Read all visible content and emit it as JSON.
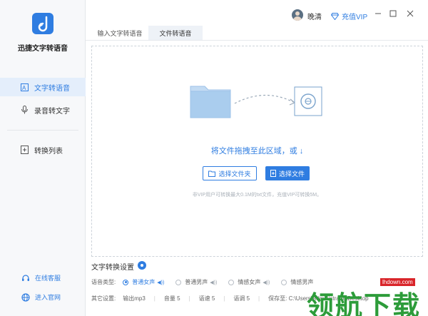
{
  "app": {
    "name": "迅捷文字转语音"
  },
  "sidebar": {
    "items": [
      {
        "label": "文字转语音"
      },
      {
        "label": "录音转文字"
      },
      {
        "label": "转换列表"
      }
    ],
    "footer": [
      {
        "label": "在线客服"
      },
      {
        "label": "进入官网"
      }
    ]
  },
  "header": {
    "username": "晚清",
    "vip_label": "充值VIP"
  },
  "tabs": [
    {
      "label": "输入文字转语音"
    },
    {
      "label": "文件转语音"
    }
  ],
  "dropzone": {
    "text": "将文件拖拽至此区域，或 ↓",
    "select_folder": "选择文件夹",
    "select_file": "选择文件",
    "hint": "非VIP用户可转换最大0.1M的txt文件，充值VIP可转换5M。"
  },
  "settings": {
    "title": "文字转换设置",
    "voice_label": "语音类型:",
    "voices": [
      {
        "label": "普通女声"
      },
      {
        "label": "普通男声"
      },
      {
        "label": "情感女声"
      },
      {
        "label": "情感男声"
      }
    ],
    "other_label": "其它设置:",
    "output": "输出mp3",
    "volume": "音量 5",
    "speed": "语速 5",
    "pitch": "语调 5",
    "save_to": "保存至: C:\\Users\\Administrator\\Desktop"
  },
  "watermark": {
    "url": "lhdown.com",
    "text": "领航下载"
  },
  "colors": {
    "accent": "#2f7de1",
    "sidebar_bg": "#f7f8fa"
  }
}
